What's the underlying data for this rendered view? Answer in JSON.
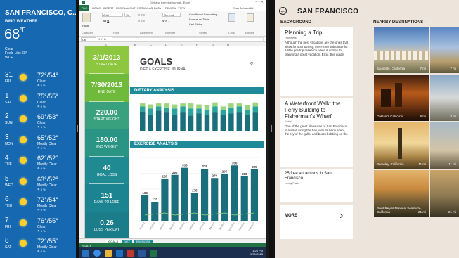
{
  "weather": {
    "city": "SAN FRANCISCO, C...",
    "app_name": "BING WEATHER",
    "current_temp": "68",
    "unit": "°F",
    "condition": "Clear",
    "feels_like": "Feels Like 68°",
    "wind": "WCF",
    "forecast": [
      {
        "date": "31",
        "day": "FRI",
        "hilo": "72°/54°",
        "cond": "Clear",
        "precip": "0 %"
      },
      {
        "date": "1",
        "day": "SAT",
        "hilo": "75°/55°",
        "cond": "Clear",
        "precip": "0 %"
      },
      {
        "date": "2",
        "day": "SUN",
        "hilo": "69°/53°",
        "cond": "Clear",
        "precip": "0 %"
      },
      {
        "date": "3",
        "day": "MON",
        "hilo": "65°/52°",
        "cond": "Mostly Clear",
        "precip": "0 %"
      },
      {
        "date": "4",
        "day": "TUE",
        "hilo": "62°/52°",
        "cond": "Mostly Clear",
        "precip": "0 %"
      },
      {
        "date": "5",
        "day": "WED",
        "hilo": "63°/52°",
        "cond": "Mostly Clear",
        "precip": "0 %"
      },
      {
        "date": "6",
        "day": "THU",
        "hilo": "72°/54°",
        "cond": "Mostly Clear",
        "precip": "0 %"
      },
      {
        "date": "7",
        "day": "FRI",
        "hilo": "76°/55°",
        "cond": "Clear",
        "precip": "0 %"
      },
      {
        "date": "8",
        "day": "SAT",
        "hilo": "72°/55°",
        "cond": "Mostly Clear",
        "precip": "0 %"
      }
    ]
  },
  "excel": {
    "window_title": "Diet and exercise journal - Excel",
    "user": "Elisa Sahsenkild",
    "ribbon_tabs": [
      "FILE",
      "HOME",
      "INSERT",
      "PAGE LAYOUT",
      "FORMULAS",
      "DATA",
      "REVIEW",
      "VIEW"
    ],
    "ribbon": {
      "paste": "Paste",
      "clipboard": "Clipboard",
      "font": "Font",
      "alignment": "Alignment",
      "number": "Number",
      "styles": "Styles",
      "cells": "Cells",
      "editing": "Editing",
      "font_name": "Arial",
      "font_size": "11",
      "number_format": "General",
      "conditional": "Conditional Formatting",
      "format_table": "Format as Table",
      "cell_styles": "Cell Styles"
    },
    "name_box": "C6",
    "columns": [
      "A",
      "B",
      "C",
      "D",
      "E",
      "F",
      "G",
      "H"
    ],
    "kpis": [
      {
        "value": "3/1/2013",
        "label": "START DATE",
        "color": "#8dc63f"
      },
      {
        "value": "7/30/2013",
        "label": "END DATE",
        "color": "#6fba3b"
      },
      {
        "value": "220.00",
        "label": "START WEIGHT",
        "color": "#3aa17e"
      },
      {
        "value": "180.00",
        "label": "END WEIGHT",
        "color": "#2b9585"
      },
      {
        "value": "40",
        "label": "GOAL LOSS",
        "color": "#1f8a92"
      },
      {
        "value": "151",
        "label": "DAYS TO LOSE",
        "color": "#1c8490"
      },
      {
        "value": "0.26",
        "label": "LOSS PER DAY",
        "color": "#1b7c8a"
      }
    ],
    "goals_title": "GOALS",
    "goals_subtitle": "DIET & EXERCISE JOURNAL",
    "diet_title": "DIETARY ANALYSIS",
    "exercise_title": "EXERCISE ANALYSIS",
    "sheet_tabs": [
      "GOALS",
      "DIET",
      "EXERCISE"
    ],
    "status": "READY",
    "clock_time": "1:25 PM",
    "clock_date": "5/31/2013",
    "colors": {
      "excel_green": "#217346",
      "teal": "#1f8a99",
      "diet_dark": "#1b6f7c",
      "diet_mid": "#2aa39a",
      "diet_light": "#9dd47d"
    }
  },
  "chart_data": [
    {
      "type": "bar",
      "title": "DIETARY ANALYSIS",
      "series": [
        {
          "values": [
            38,
            32,
            40,
            36,
            32,
            36,
            30,
            34,
            32,
            36,
            32,
            34,
            36,
            32,
            36
          ]
        },
        {
          "values": [
            10,
            12,
            8,
            10,
            12,
            12,
            14,
            10,
            10,
            12,
            10,
            12,
            12,
            10,
            12
          ]
        },
        {
          "values": [
            6,
            8,
            6,
            8,
            8,
            6,
            10,
            8,
            8,
            8,
            6,
            8,
            6,
            8,
            8
          ]
        }
      ]
    },
    {
      "type": "bar",
      "title": "EXERCISE ANALYSIS",
      "categories": [
        "3/1/2013",
        "3/2/2013",
        "3/3/2013",
        "3/4/2013",
        "3/5/2013",
        "3/6/2013",
        "3/7/2013",
        "3/8/2013",
        "3/9/2013",
        "3/10/2013",
        "3/11/2013",
        "3/12/2013"
      ],
      "values": [
        160,
        120,
        265,
        290,
        335,
        175,
        328,
        270,
        295,
        350,
        280,
        325
      ],
      "ylim": [
        0,
        400
      ]
    }
  ],
  "travel": {
    "title": "SAN FRANCISCO",
    "background_label": "BACKGROUND ›",
    "nearby_label": "NEARBY DESTINATIONS ›",
    "cards": [
      {
        "title": "Planning a Trip",
        "source": "Frommer's",
        "body": "Although the best vacations are the ones that allow for spontaneity, there's no substitute for a little pre-trip research when it comes to planning a great vacation. Ergo, this guide."
      },
      {
        "title": "A Waterfront Walk: the Ferry Building to Fisherman's Wharf",
        "source": "Fodor's",
        "body": "One of the great pleasures of San Francisco is a stroll along the bay, with its briny scent, the cry of the gulls, and boats bobbing on the"
      },
      {
        "title": "25 free attractions in San Francisco",
        "source": "Lonely Planet",
        "body": ""
      }
    ],
    "more_label": "MORE",
    "destinations": [
      {
        "name": "Sausalito, California",
        "dist": "7 mi"
      },
      {
        "name": "Oakland, California",
        "dist": "8 mi"
      },
      {
        "name": "Berkeley, California",
        "dist": "11 mi"
      },
      {
        "name": "Point Reyes National Seashore, California",
        "dist": "21 mi"
      }
    ],
    "colors": {
      "bg": "#ede5dc"
    }
  }
}
